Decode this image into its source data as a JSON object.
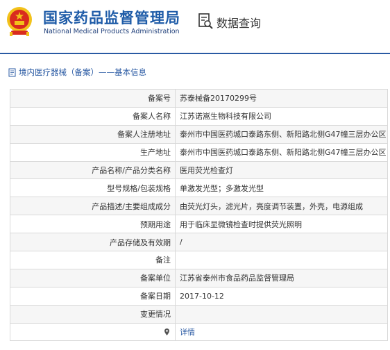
{
  "header": {
    "title_cn": "国家药品监督管理局",
    "title_en": "National Medical Products Administration",
    "query_label": "数据查询",
    "emblem_icon": "national-emblem-icon",
    "query_icon": "document-search-icon"
  },
  "section": {
    "title": "境内医疗器械（备案）——基本信息",
    "icon": "document-icon"
  },
  "table": {
    "rows": [
      {
        "label": "备案号",
        "value": "苏泰械备20170299号"
      },
      {
        "label": "备案人名称",
        "value": "江苏诺嵩生物科技有限公司"
      },
      {
        "label": "备案人注册地址",
        "value": "泰州市中国医药城口泰路东侧、新阳路北侧G47幢三层办公区"
      },
      {
        "label": "生产地址",
        "value": "泰州市中国医药城口泰路东侧、新阳路北侧G47幢三层办公区"
      },
      {
        "label": "产品名称/产品分类名称",
        "value": "医用荧光检查灯"
      },
      {
        "label": "型号规格/包装规格",
        "value": "单激发光型；多激发光型"
      },
      {
        "label": "产品描述/主要组成成分",
        "value": "由荧光灯头，滤光片，亮度调节装置，外壳，电源组成"
      },
      {
        "label": "预期用途",
        "value": "用于临床显微镜检查时提供荧光照明"
      },
      {
        "label": "产品存储及有效期",
        "value": "/"
      },
      {
        "label": "备注",
        "value": ""
      },
      {
        "label": "备案单位",
        "value": "江苏省泰州市食品药品监督管理局"
      },
      {
        "label": "备案日期",
        "value": "2017-10-12"
      },
      {
        "label": "变更情况",
        "value": ""
      },
      {
        "label": "",
        "value": "详情",
        "icon": "location-pin-icon"
      }
    ]
  },
  "colors": {
    "brand_blue": "#1f5ca8",
    "link_blue": "#2a5aa3",
    "emblem_red": "#d92b1e",
    "emblem_gold": "#f2c21a"
  }
}
